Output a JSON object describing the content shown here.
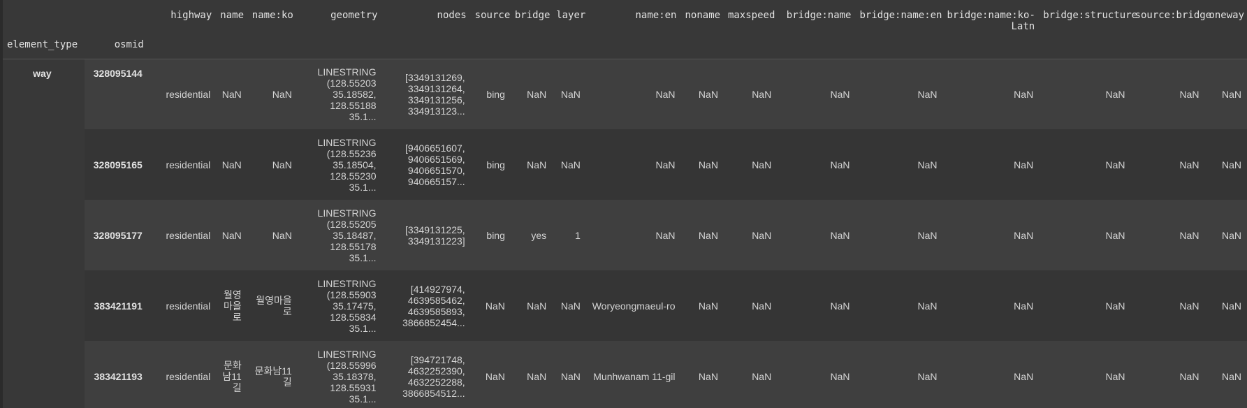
{
  "columns": {
    "highway": "highway",
    "name": "name",
    "name_ko": "name:ko",
    "geometry": "geometry",
    "nodes": "nodes",
    "source": "source",
    "bridge": "bridge",
    "layer": "layer",
    "name_en": "name:en",
    "noname": "noname",
    "maxspeed": "maxspeed",
    "bridge_name": "bridge:name",
    "bridge_name_en": "bridge:name:en",
    "bridge_name_ko_latn": "bridge:name:ko-Latn",
    "bridge_structure": "bridge:structure",
    "source_bridge": "source:bridge",
    "oneway": "oneway"
  },
  "index_names": {
    "element_type": "element_type",
    "osmid": "osmid"
  },
  "element_type_value": "way",
  "rows": [
    {
      "osmid": "328095144",
      "highway": "residential",
      "name": "NaN",
      "name_ko": "NaN",
      "geometry": "LINESTRING (128.55203 35.18582, 128.55188 35.1...",
      "nodes": "[3349131269, 3349131264, 3349131256, 334913123...",
      "source": "bing",
      "bridge": "NaN",
      "layer": "NaN",
      "name_en": "NaN",
      "noname": "NaN",
      "maxspeed": "NaN",
      "bridge_name": "NaN",
      "bridge_name_en": "NaN",
      "bridge_name_ko_latn": "NaN",
      "bridge_structure": "NaN",
      "source_bridge": "NaN",
      "oneway": "NaN"
    },
    {
      "osmid": "328095165",
      "highway": "residential",
      "name": "NaN",
      "name_ko": "NaN",
      "geometry": "LINESTRING (128.55236 35.18504, 128.55230 35.1...",
      "nodes": "[9406651607, 9406651569, 9406651570, 940665157...",
      "source": "bing",
      "bridge": "NaN",
      "layer": "NaN",
      "name_en": "NaN",
      "noname": "NaN",
      "maxspeed": "NaN",
      "bridge_name": "NaN",
      "bridge_name_en": "NaN",
      "bridge_name_ko_latn": "NaN",
      "bridge_structure": "NaN",
      "source_bridge": "NaN",
      "oneway": "NaN"
    },
    {
      "osmid": "328095177",
      "highway": "residential",
      "name": "NaN",
      "name_ko": "NaN",
      "geometry": "LINESTRING (128.55205 35.18487, 128.55178 35.1...",
      "nodes": "[3349131225, 3349131223]",
      "source": "bing",
      "bridge": "yes",
      "layer": "1",
      "name_en": "NaN",
      "noname": "NaN",
      "maxspeed": "NaN",
      "bridge_name": "NaN",
      "bridge_name_en": "NaN",
      "bridge_name_ko_latn": "NaN",
      "bridge_structure": "NaN",
      "source_bridge": "NaN",
      "oneway": "NaN"
    },
    {
      "osmid": "383421191",
      "highway": "residential",
      "name": "월영마을로",
      "name_ko": "월영마을로",
      "geometry": "LINESTRING (128.55903 35.17475, 128.55834 35.1...",
      "nodes": "[414927974, 4639585462, 4639585893, 3866852454...",
      "source": "NaN",
      "bridge": "NaN",
      "layer": "NaN",
      "name_en": "Woryeongmaeul-ro",
      "noname": "NaN",
      "maxspeed": "NaN",
      "bridge_name": "NaN",
      "bridge_name_en": "NaN",
      "bridge_name_ko_latn": "NaN",
      "bridge_structure": "NaN",
      "source_bridge": "NaN",
      "oneway": "NaN"
    },
    {
      "osmid": "383421193",
      "highway": "residential",
      "name": "문화남11길",
      "name_ko": "문화남11길",
      "geometry": "LINESTRING (128.55996 35.18378, 128.55931 35.1...",
      "nodes": "[394721748, 4632252390, 4632252288, 3866854512...",
      "source": "NaN",
      "bridge": "NaN",
      "layer": "NaN",
      "name_en": "Munhwanam 11-gil",
      "noname": "NaN",
      "maxspeed": "NaN",
      "bridge_name": "NaN",
      "bridge_name_en": "NaN",
      "bridge_name_ko_latn": "NaN",
      "bridge_structure": "NaN",
      "source_bridge": "NaN",
      "oneway": "NaN"
    }
  ]
}
